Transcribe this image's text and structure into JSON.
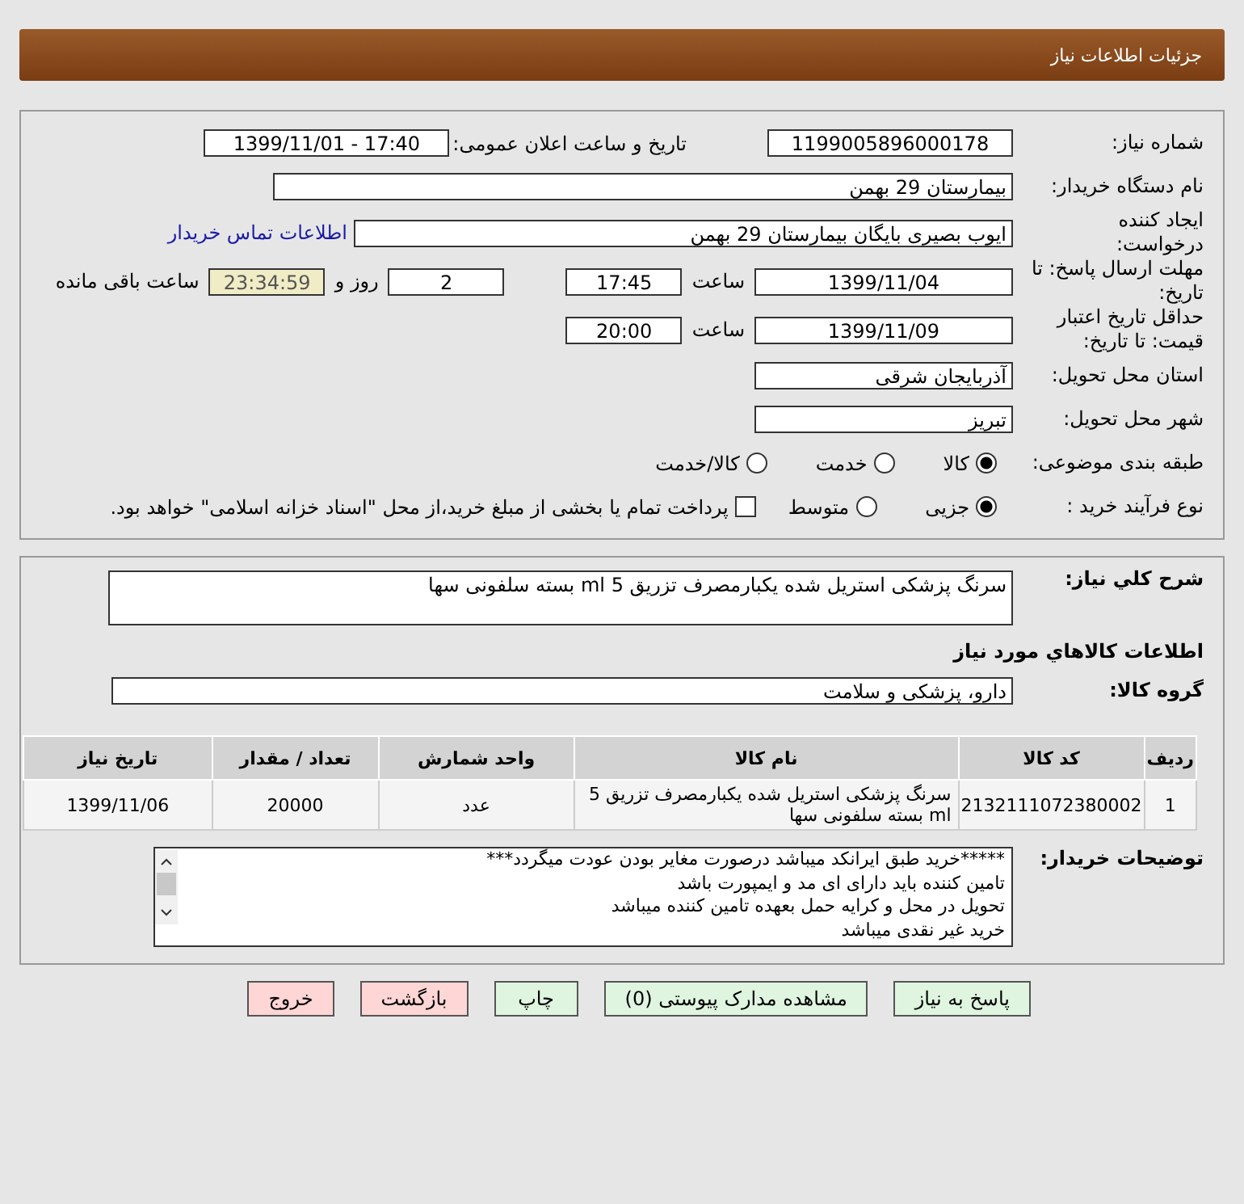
{
  "header": {
    "title": "جزئیات اطلاعات نیاز"
  },
  "details": {
    "need_number": {
      "label": "شماره نیاز:",
      "value": "1199005896000178"
    },
    "announce_date": {
      "label": "تاریخ و ساعت اعلان عمومی:",
      "value": "1399/11/01 - 17:40"
    },
    "buyer_org": {
      "label": "نام دستگاه خریدار:",
      "value": "بیمارستان 29 بهمن"
    },
    "creator": {
      "label": "ایجاد کننده درخواست:",
      "value": "ایوب بصیری  بایگان بیمارستان 29 بهمن",
      "link": "اطلاعات تماس خریدار"
    },
    "reply_deadline": {
      "label": "مهلت ارسال پاسخ: تا تاریخ:",
      "date": "1399/11/04",
      "time_label": "ساعت",
      "time": "17:45",
      "days": "2",
      "days_label": "روز و",
      "remaining": "23:34:59",
      "remaining_label": "ساعت باقی مانده"
    },
    "price_validity": {
      "label": "حداقل تاریخ اعتبار قیمت: تا تاریخ:",
      "date": "1399/11/09",
      "time_label": "ساعت",
      "time": "20:00"
    },
    "province": {
      "label": "استان محل تحویل:",
      "value": "آذربایجان شرقی"
    },
    "city": {
      "label": "شهر محل تحویل:",
      "value": "تبریز"
    },
    "category": {
      "label": "طبقه بندی موضوعی:",
      "options": [
        {
          "label": "کالا",
          "selected": true
        },
        {
          "label": "خدمت",
          "selected": false
        },
        {
          "label": "کالا/خدمت",
          "selected": false
        }
      ]
    },
    "process": {
      "label": "نوع فرآیند خرید :",
      "options": [
        {
          "label": "جزیی",
          "selected": true
        },
        {
          "label": "متوسط",
          "selected": false
        }
      ],
      "payment": {
        "label": "پرداخت تمام یا بخشی از مبلغ خرید،از محل \"اسناد خزانه اسلامی\" خواهد بود.",
        "checked": false
      }
    }
  },
  "goods": {
    "summary_label": "شرح کلي نياز:",
    "summary": "سرنگ پزشکی استریل شده یکبارمصرف تزریق 5 ml بسته سلفونی سها",
    "heading": "اطلاعات كالاهاي مورد نياز",
    "group_label": "گروه کالا:",
    "group": "دارو، پزشکی و سلامت",
    "table": {
      "columns": [
        "ردیف",
        "کد کالا",
        "نام کالا",
        "واحد شمارش",
        "تعداد / مقدار",
        "تاریخ نیاز"
      ],
      "rows": [
        [
          "1",
          "2132111072380002",
          "سرنگ پزشکی استریل شده یکبارمصرف تزریق 5 ml بسته سلفونی سها",
          "عدد",
          "20000",
          "1399/11/06"
        ]
      ]
    },
    "notes_label": "توضیحات خریدار:",
    "notes": [
      "*****خرید طبق ایرانکد میباشد درصورت مغایر بودن عودت میگردد***",
      "تامین کننده باید دارای ای مد و ایمپورت باشد",
      "تحویل در محل و کرایه حمل بعهده تامین کننده میباشد",
      "خرید غیر نقدی میباشد"
    ]
  },
  "buttons": [
    {
      "label": "پاسخ به نیاز",
      "kind": "normal"
    },
    {
      "label": "مشاهده مدارک پیوستی (0)",
      "kind": "normal"
    },
    {
      "label": "چاپ",
      "kind": "normal"
    },
    {
      "label": "بازگشت",
      "kind": "exit"
    },
    {
      "label": "خروج",
      "kind": "exit"
    }
  ]
}
